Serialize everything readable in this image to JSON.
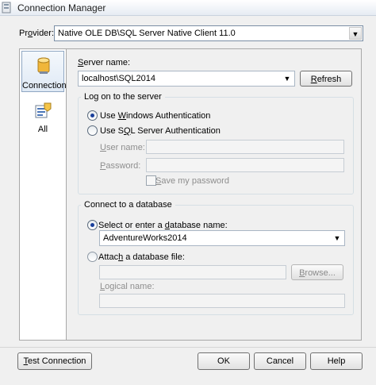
{
  "window": {
    "title": "Connection Manager"
  },
  "provider": {
    "label_pre": "Pr",
    "label_u": "o",
    "label_post": "vider:",
    "value": "Native OLE DB\\SQL Server Native Client 11.0"
  },
  "nav": {
    "items": [
      {
        "label": "Connection",
        "selected": true,
        "icon": "database-cylinder-icon"
      },
      {
        "label": "All",
        "selected": false,
        "icon": "properties-list-icon"
      }
    ]
  },
  "server": {
    "label_u": "S",
    "label_post": "erver name:",
    "value": "localhost\\SQL2014",
    "refresh_u": "R",
    "refresh_post": "efresh"
  },
  "logon": {
    "title": "Log on to the server",
    "windows_pre": "Use ",
    "windows_u": "W",
    "windows_post": "indows Authentication",
    "windows_checked": true,
    "sql_pre": "Use S",
    "sql_u": "Q",
    "sql_post": "L Server Authentication",
    "sql_checked": false,
    "user_u": "U",
    "user_post": "ser name:",
    "user_value": "",
    "password_u": "P",
    "password_post": "assword:",
    "password_value": "",
    "save_pre": "",
    "save_u": "S",
    "save_post": "ave my password",
    "save_checked": false
  },
  "database": {
    "title": "Connect to a database",
    "select_pre": "Select or enter a ",
    "select_u": "d",
    "select_post": "atabase name:",
    "select_checked": true,
    "db_value": "AdventureWorks2014",
    "attach_pre": "Attac",
    "attach_u": "h",
    "attach_post": " a database file:",
    "attach_checked": false,
    "attach_value": "",
    "browse_u": "B",
    "browse_post": "rowse...",
    "logical_u": "L",
    "logical_post": "ogical name:",
    "logical_value": ""
  },
  "footer": {
    "test_u": "T",
    "test_post": "est Connection",
    "ok": "OK",
    "cancel": "Cancel",
    "help": "Help"
  }
}
